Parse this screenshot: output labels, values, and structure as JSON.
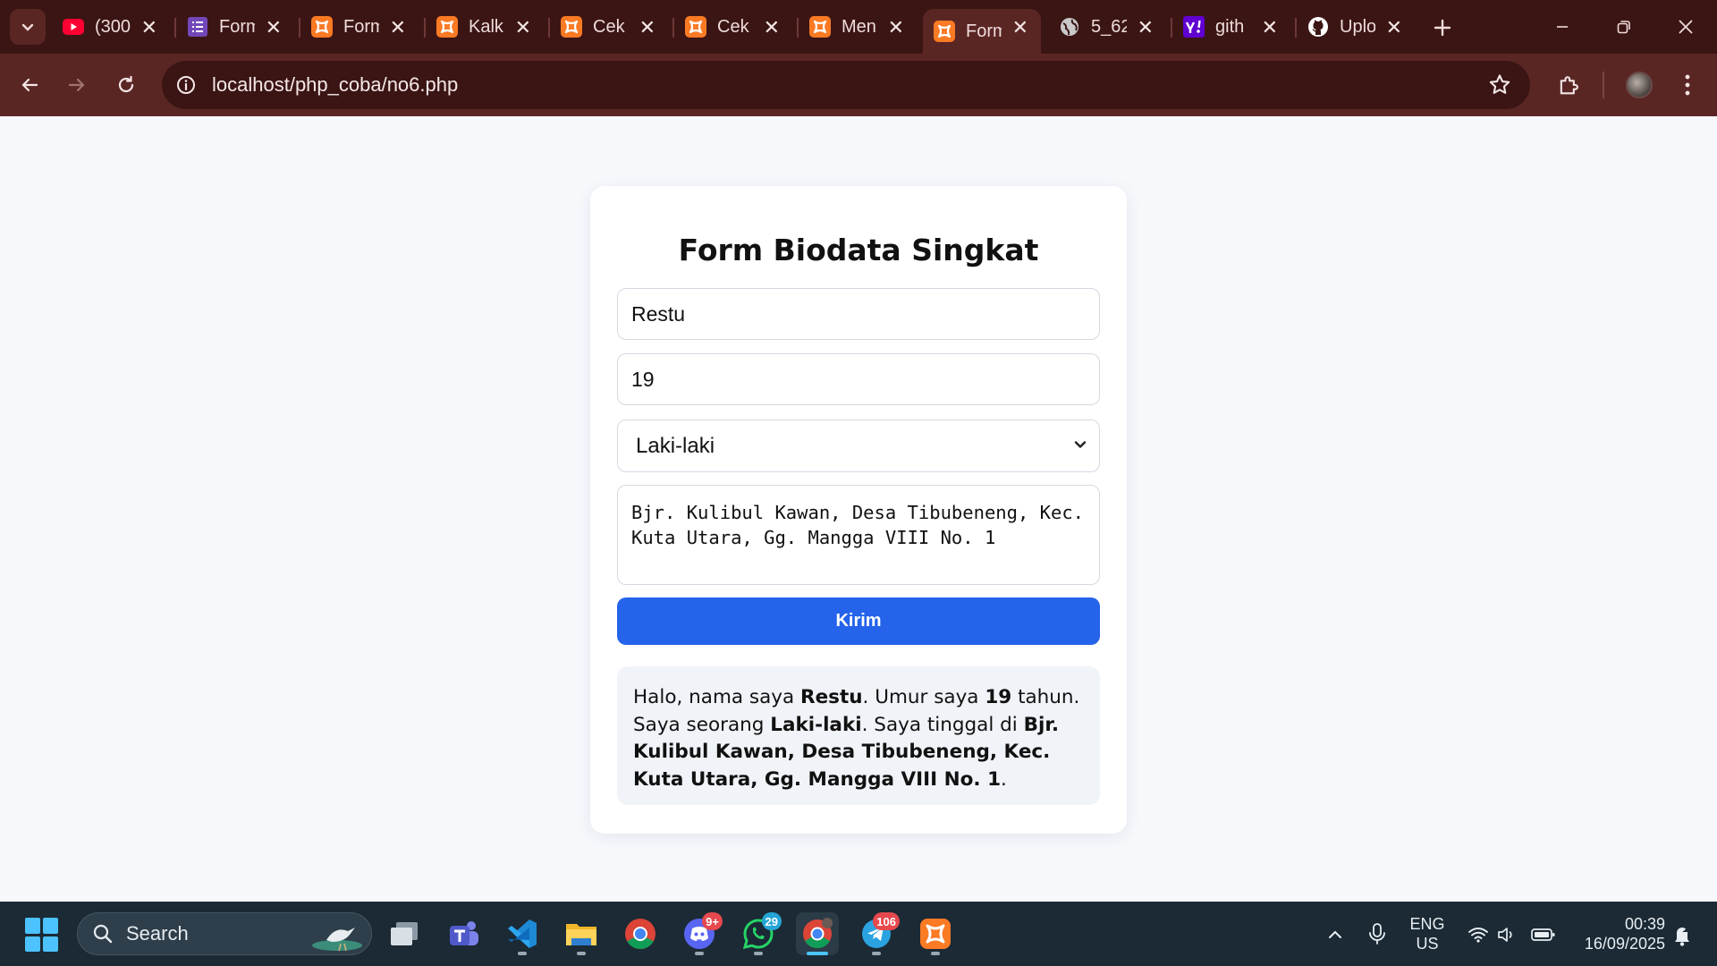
{
  "browser": {
    "tabs": [
      {
        "title": "(300",
        "favicon": "youtube-icon",
        "color": "#ff0033"
      },
      {
        "title": "Form",
        "favicon": "forms-icon",
        "color": "#7248b9"
      },
      {
        "title": "Form",
        "favicon": "xampp-icon",
        "color": "#fb7a24"
      },
      {
        "title": "Kalk",
        "favicon": "xampp-icon",
        "color": "#fb7a24"
      },
      {
        "title": "Cek",
        "favicon": "xampp-icon",
        "color": "#fb7a24"
      },
      {
        "title": "Cek",
        "favicon": "xampp-icon",
        "color": "#fb7a24"
      },
      {
        "title": "Men",
        "favicon": "xampp-icon",
        "color": "#fb7a24"
      },
      {
        "title": "Form",
        "favicon": "xampp-icon",
        "color": "#fb7a24",
        "active": true
      },
      {
        "title": "5_62",
        "favicon": "globe-icon",
        "color": "#c9c9c9"
      },
      {
        "title": "gith",
        "favicon": "yahoo-icon",
        "color": "#6001d2"
      },
      {
        "title": "Uplo",
        "favicon": "github-icon",
        "color": "#ffffff"
      }
    ],
    "close_glyph": "✕",
    "url": "localhost/php_coba/no6.php"
  },
  "form": {
    "title": "Form Biodata Singkat",
    "name_value": "Restu",
    "age_value": "19",
    "gender_value": "Laki-laki",
    "address_value": "Bjr. Kulibul Kawan, Desa Tibubeneng, Kec. Kuta Utara, Gg. Mangga VIII No. 1",
    "submit_label": "Kirim"
  },
  "result": {
    "p1": "Halo, nama saya ",
    "name": "Restu",
    "p2": ". Umur saya ",
    "age": "19",
    "p3": " tahun. Saya seorang ",
    "gender": "Laki-laki",
    "p4": ". Saya tinggal di ",
    "address": "Bjr. Kulibul Kawan, Desa Tibubeneng, Kec. Kuta Utara, Gg. Mangga VIII No. 1",
    "p5": "."
  },
  "taskbar": {
    "search_label": "Search",
    "discord_badge": "9+",
    "whatsapp_badge": "29",
    "telegram_badge": "106",
    "lang_line1": "ENG",
    "lang_line2": "US",
    "time": "00:39",
    "date": "16/09/2025"
  },
  "colors": {
    "accent": "#2563eb",
    "tab_strip": "#3b1514",
    "toolbar": "#5a2624",
    "taskbar": "#1b2a35"
  }
}
